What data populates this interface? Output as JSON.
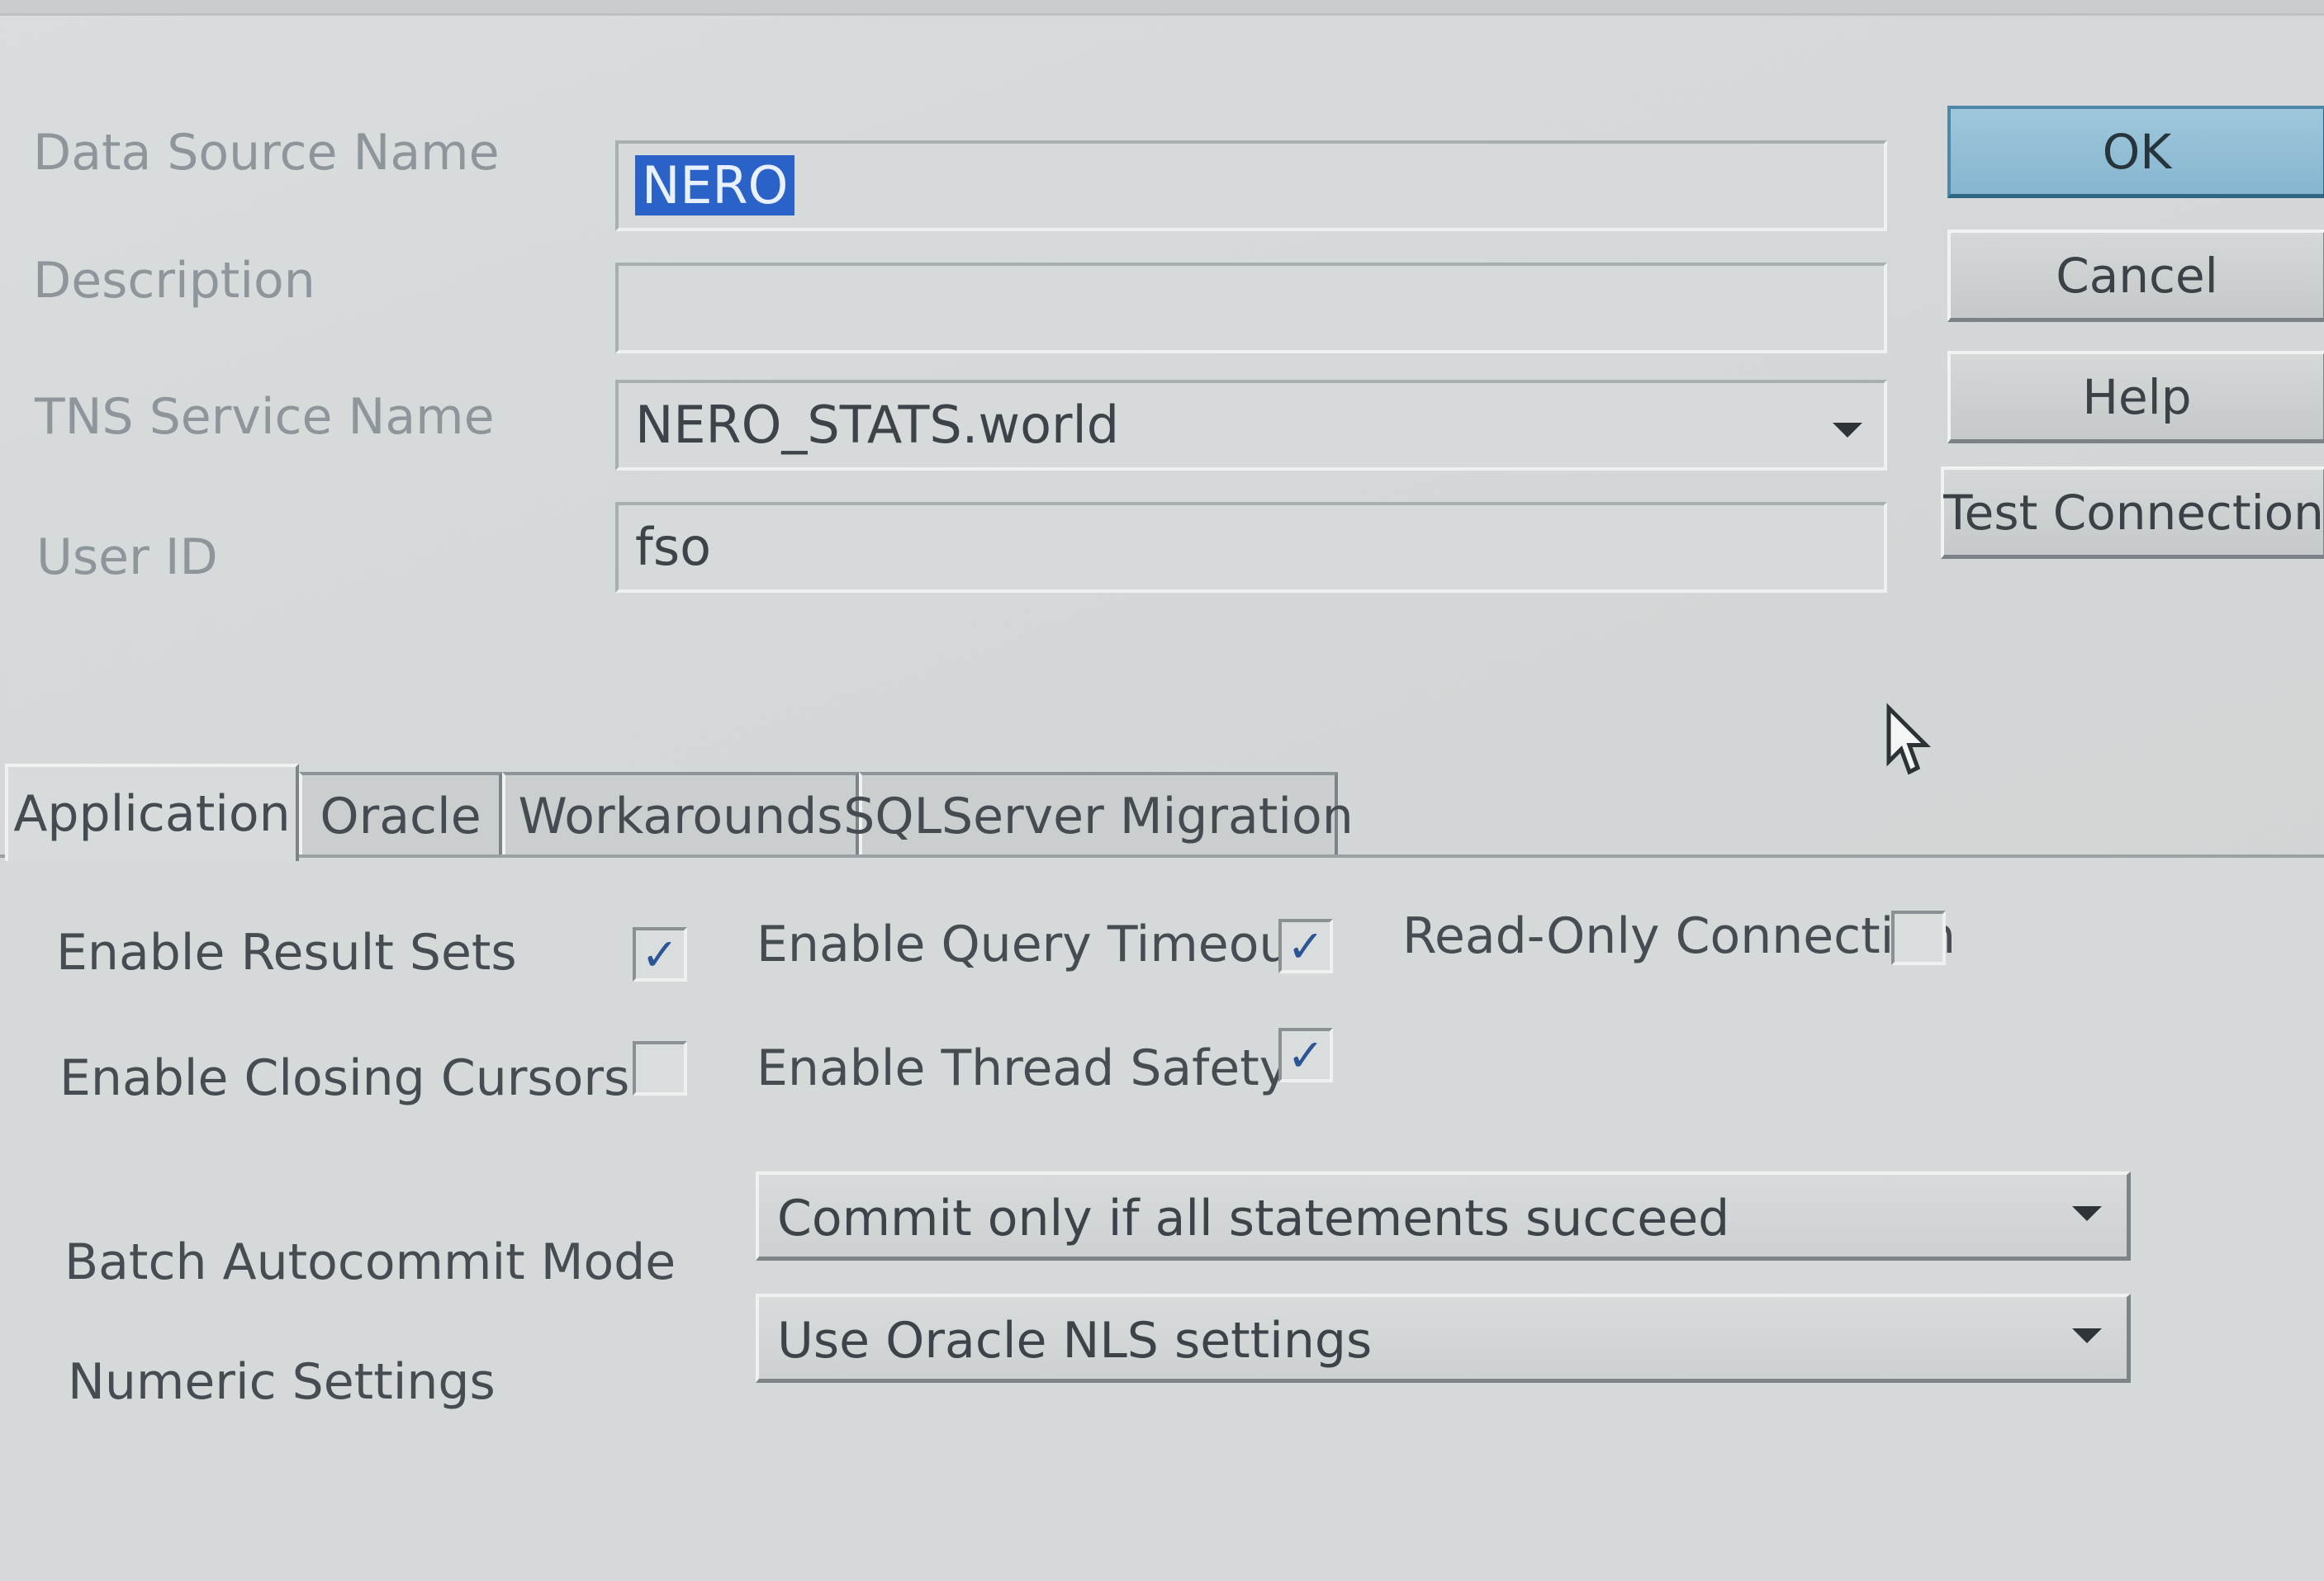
{
  "fields": {
    "data_source_name": {
      "label": "Data Source Name",
      "value": "NERO"
    },
    "description": {
      "label": "Description",
      "value": ""
    },
    "tns_service_name": {
      "label": "TNS Service Name",
      "value": "NERO_STATS.world"
    },
    "user_id": {
      "label": "User ID",
      "value": "fso"
    }
  },
  "buttons": {
    "ok": "OK",
    "cancel": "Cancel",
    "help": "Help",
    "test_connection": "Test Connection"
  },
  "tabs": [
    {
      "label": "Application",
      "active": true
    },
    {
      "label": "Oracle",
      "active": false
    },
    {
      "label": "Workarounds",
      "active": false
    },
    {
      "label": "SQLServer Migration",
      "active": false
    }
  ],
  "application": {
    "enable_result_sets": {
      "label": "Enable Result Sets",
      "checked": true
    },
    "enable_query_timeout": {
      "label": "Enable Query Timeout",
      "checked": true
    },
    "read_only_connection": {
      "label": "Read-Only Connection",
      "checked": false
    },
    "enable_closing_cursors": {
      "label": "Enable Closing Cursors",
      "checked": false
    },
    "enable_thread_safety": {
      "label": "Enable Thread Safety",
      "checked": true
    },
    "batch_autocommit_mode": {
      "label": "Batch Autocommit Mode",
      "value": "Commit only if all statements succeed"
    },
    "numeric_settings": {
      "label": "Numeric Settings",
      "value": "Use Oracle NLS settings"
    }
  },
  "icons": {
    "check_glyph": "✓",
    "dropdown": "chevron-down-icon",
    "pointer": "mouse-pointer-icon"
  },
  "colors": {
    "selection": "#2b62c8",
    "default_button": "#8fbdd4",
    "checkmark": "#2c5596"
  }
}
